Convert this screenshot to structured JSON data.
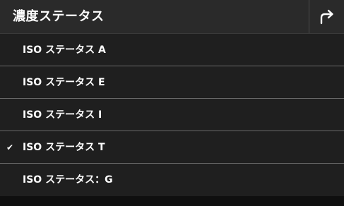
{
  "header": {
    "title": "濃度ステータス",
    "back_icon": "return-arrow-icon"
  },
  "list": {
    "items": [
      {
        "label": "ISO ステータス A",
        "selected": false
      },
      {
        "label": "ISO ステータス E",
        "selected": false
      },
      {
        "label": "ISO ステータス I",
        "selected": false
      },
      {
        "label": "ISO ステータス T",
        "selected": true
      },
      {
        "label": "ISO ステータス：G",
        "selected": false
      }
    ],
    "check_mark": "✔"
  },
  "colors": {
    "background": "#1e1e1e",
    "header": "#2a2a2a",
    "divider": "#6a6a6a",
    "text": "#ffffff"
  }
}
